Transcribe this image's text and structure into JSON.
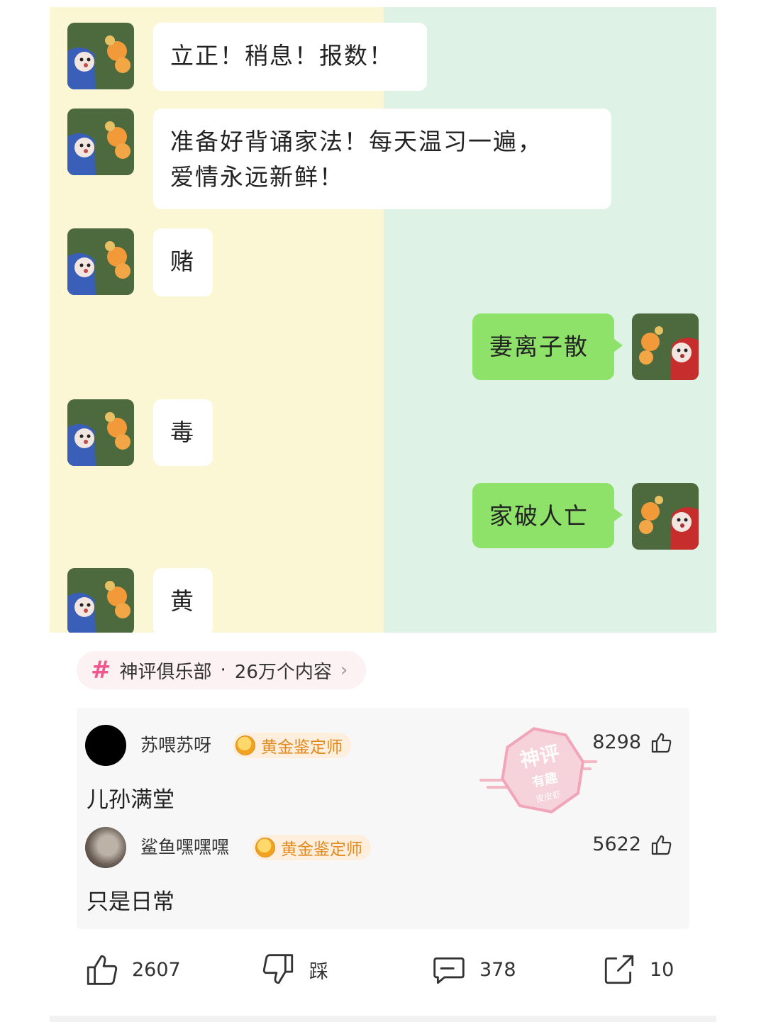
{
  "chat": {
    "messages": [
      {
        "side": "left",
        "text": "立正！稍息！报数！"
      },
      {
        "side": "left",
        "text": "准备好背诵家法！每天温习一遍，\n爱情永远新鲜！"
      },
      {
        "side": "left",
        "text": "赌"
      },
      {
        "side": "right",
        "text": "妻离子散"
      },
      {
        "side": "left",
        "text": "毒"
      },
      {
        "side": "right",
        "text": "家破人亡"
      },
      {
        "side": "left",
        "text": "黄"
      }
    ],
    "colors": {
      "left_bg": "#fbf6d3",
      "right_bg": "#dff2e6",
      "bubble_green": "#8ee26a"
    }
  },
  "topic": {
    "name": "神评俱乐部",
    "separator": "·",
    "count": "26万个内容"
  },
  "comments": [
    {
      "user": "苏喂苏呀",
      "badge": "黄金鉴定师",
      "likes": "8298",
      "text": "儿孙满堂"
    },
    {
      "user": "鲨鱼嘿嘿嘿",
      "badge": "黄金鉴定师",
      "likes": "5622",
      "text": "只是日常"
    }
  ],
  "stamp": {
    "line1": "神评",
    "line2": "有趣",
    "line3": "皮皮虾"
  },
  "actions": {
    "like": "2607",
    "dislike": "踩",
    "comment": "378",
    "share": "10"
  }
}
